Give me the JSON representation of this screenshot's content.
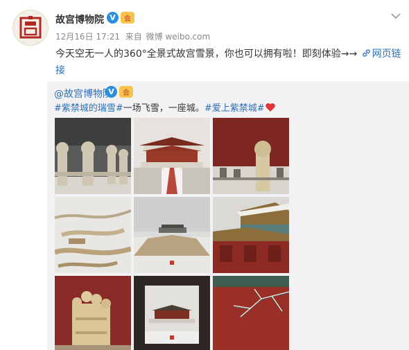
{
  "author": {
    "name": "故宫博物院",
    "verified_mark": "V",
    "member_mark": "会",
    "avatar_icon": "palace-seal-icon"
  },
  "meta": {
    "date": "12月16日",
    "time": "17:21",
    "source_label": "来自",
    "source_value": "微博 weibo.com"
  },
  "post": {
    "text": "今天空无一人的360°全景式故宫雪景，你也可以拥有啦！即刻体验→→",
    "link_label": "网页链接",
    "link_icon": "link-icon"
  },
  "retweet": {
    "author": "@故宫博物院",
    "verified_mark": "V",
    "member_mark": "会",
    "tag1": "#紫禁城的瑞雪#",
    "text_mid": "一场飞雪，一座城。",
    "tag2": "#爱上紫禁城#",
    "emoji": "heart-icon"
  },
  "colors": {
    "link": "#2b6fb5",
    "verified": "#2b8fe0",
    "palace_red": "#8e2a24",
    "retweet_bg": "#f2f2f5"
  },
  "photos": [
    "snowy-stone-railings",
    "taihe-hall-snow",
    "stone-pillar-red-wall",
    "winding-bridge-snow",
    "moat-bridge-snow",
    "palace-roof-snow",
    "carved-tower-red-wall",
    "gate-view-snow",
    "snowy-branch-red-wall"
  ]
}
